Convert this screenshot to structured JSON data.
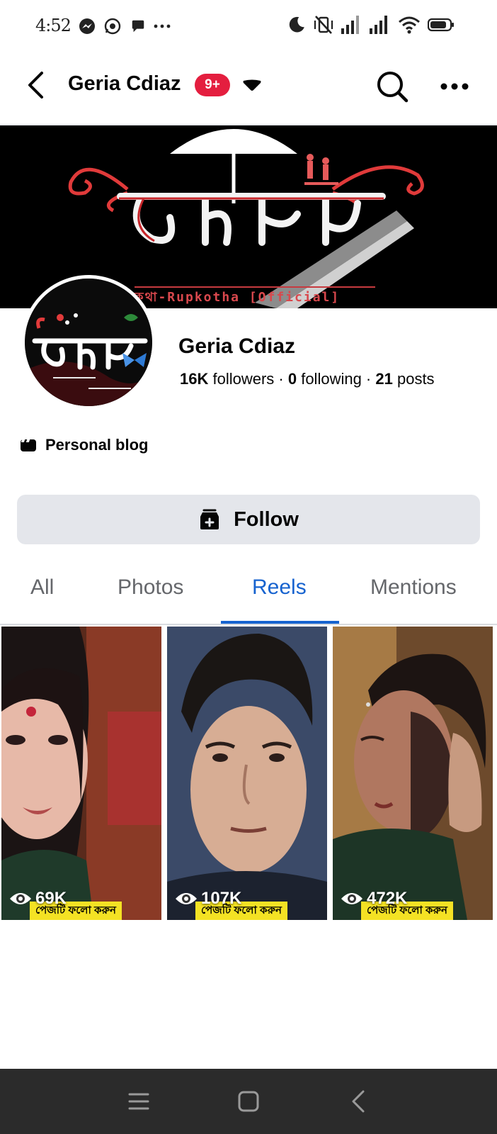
{
  "status_bar": {
    "time": "4:52",
    "left_icons": [
      "messenger-icon",
      "whatsapp-icon",
      "chat-bubble-icon",
      "more-dots-icon"
    ],
    "right_icons": [
      "do-not-disturb-moon-icon",
      "vibrate-off-icon",
      "signal-bars-icon",
      "signal-bars-icon",
      "wifi-icon",
      "battery-icon"
    ]
  },
  "app_bar": {
    "title": "Geria Cdiaz",
    "badge": "9+",
    "icons": [
      "back-arrow-icon",
      "caret-down-icon",
      "search-icon",
      "more-horizontal-icon"
    ]
  },
  "profile": {
    "name": "Geria Cdiaz",
    "followers_count": "16K",
    "followers_label": " followers · ",
    "following_count": "0",
    "following_label": " following · ",
    "posts_count": "21",
    "posts_label": " posts",
    "category": "Personal blog",
    "category_icon": "clapperboard-icon"
  },
  "follow_button": {
    "label": "Follow",
    "icon": "follow-add-icon"
  },
  "tabs": [
    {
      "label": "All",
      "active": false
    },
    {
      "label": "Photos",
      "active": false
    },
    {
      "label": "Reels",
      "active": true
    },
    {
      "label": "Mentions",
      "active": false
    }
  ],
  "reels": [
    {
      "views": "69K",
      "caption": "পেজটি ফলো করুন"
    },
    {
      "views": "107K",
      "caption": "পেজটি ফলো করুন"
    },
    {
      "views": "472K",
      "caption": "পেজটি ফলো করুন"
    }
  ],
  "nav_bar": {
    "icons": [
      "menu-icon",
      "home-square-icon",
      "back-chevron-icon"
    ]
  },
  "colors": {
    "accent": "#1763cf",
    "badge": "#e41e3f",
    "follow_bg": "#e4e6eb",
    "caption_bg": "#f4e224",
    "nav_bg": "#2b2b2b"
  }
}
